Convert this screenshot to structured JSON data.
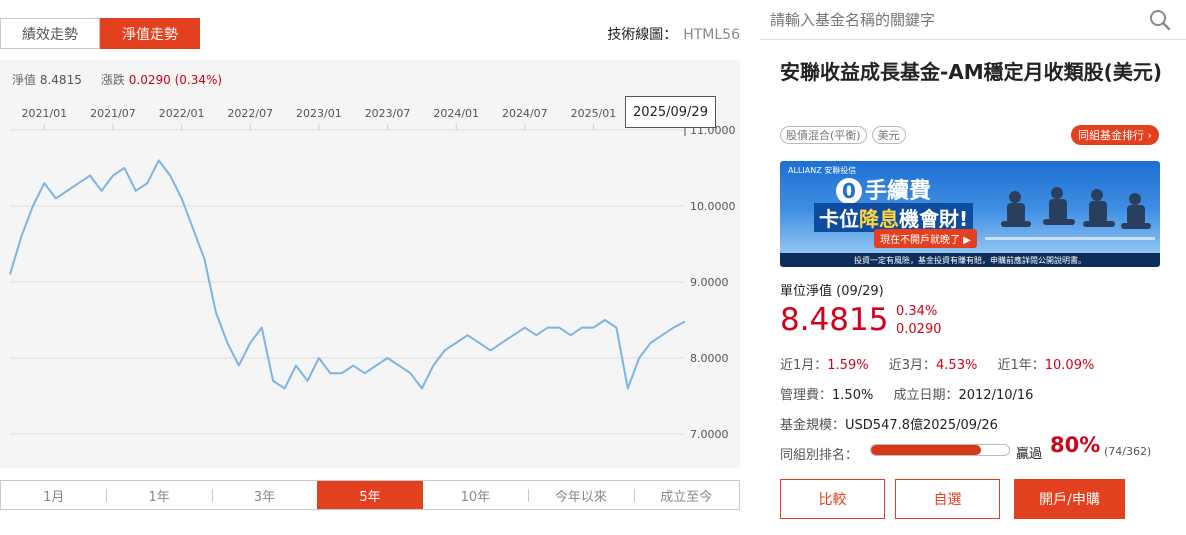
{
  "tabs": [
    {
      "label": "績效走勢",
      "active": false
    },
    {
      "label": "淨值走勢",
      "active": true
    }
  ],
  "tech": {
    "label": "技術線圖：",
    "value": "HTML56"
  },
  "nav_line": {
    "nav_label": "淨值",
    "nav_value": "8.4815",
    "change_label": "漲跌",
    "change_value": "0.0290 (0.34%)"
  },
  "tooltip_date": "2025/09/29",
  "ranges": [
    {
      "label": "1月",
      "active": false
    },
    {
      "label": "1年",
      "active": false
    },
    {
      "label": "3年",
      "active": false
    },
    {
      "label": "5年",
      "active": true
    },
    {
      "label": "10年",
      "active": false
    },
    {
      "label": "今年以來",
      "active": false
    },
    {
      "label": "成立至今",
      "active": false
    }
  ],
  "chart_data": {
    "type": "line",
    "title": "",
    "xlabel": "",
    "ylabel": "",
    "ylim": [
      7.0,
      11.0
    ],
    "y_ticks": [
      "11.0000",
      "10.0000",
      "9.0000",
      "8.0000",
      "7.0000"
    ],
    "x_ticks": [
      "2021/01",
      "2021/07",
      "2022/01",
      "2022/07",
      "2023/01",
      "2023/07",
      "2024/01",
      "2024/07",
      "2025/01"
    ],
    "grid": true,
    "line_color": "#7cb4e6",
    "series": [
      {
        "x": [
          "2020/10",
          "2020/11",
          "2020/12",
          "2021/01",
          "2021/02",
          "2021/03",
          "2021/04",
          "2021/05",
          "2021/06",
          "2021/07",
          "2021/08",
          "2021/09",
          "2021/10",
          "2021/11",
          "2021/12",
          "2022/01",
          "2022/02",
          "2022/03",
          "2022/04",
          "2022/05",
          "2022/06",
          "2022/07",
          "2022/08",
          "2022/09",
          "2022/10",
          "2022/11",
          "2022/12",
          "2023/01",
          "2023/02",
          "2023/03",
          "2023/04",
          "2023/05",
          "2023/06",
          "2023/07",
          "2023/08",
          "2023/09",
          "2023/10",
          "2023/11",
          "2023/12",
          "2024/01",
          "2024/02",
          "2024/03",
          "2024/04",
          "2024/05",
          "2024/06",
          "2024/07",
          "2024/08",
          "2024/09",
          "2024/10",
          "2024/11",
          "2024/12",
          "2025/01",
          "2025/02",
          "2025/03",
          "2025/04",
          "2025/05",
          "2025/06",
          "2025/07",
          "2025/08",
          "2025/09"
        ],
        "values": [
          9.1,
          9.6,
          10.0,
          10.3,
          10.1,
          10.2,
          10.3,
          10.4,
          10.2,
          10.4,
          10.5,
          10.2,
          10.3,
          10.6,
          10.4,
          10.1,
          9.7,
          9.3,
          8.6,
          8.2,
          7.9,
          8.2,
          8.4,
          7.7,
          7.6,
          7.9,
          7.7,
          8.0,
          7.8,
          7.8,
          7.9,
          7.8,
          7.9,
          8.0,
          7.9,
          7.8,
          7.6,
          7.9,
          8.1,
          8.2,
          8.3,
          8.2,
          8.1,
          8.2,
          8.3,
          8.4,
          8.3,
          8.4,
          8.4,
          8.3,
          8.4,
          8.4,
          8.5,
          8.4,
          7.6,
          8.0,
          8.2,
          8.3,
          8.4,
          8.48
        ]
      }
    ]
  },
  "search": {
    "placeholder": "請輸入基金名稱的關鍵字"
  },
  "fund": {
    "name": "安聯收益成長基金-AM穩定月收類股(美元)",
    "tags": [
      "股債混合(平衡)",
      "美元"
    ],
    "peer_rank_link": "同組基金排行 ›"
  },
  "banner": {
    "brand": "ALLIANZ 安聯投信",
    "line1_zero": "0",
    "line1": "手續費",
    "line2_a": "卡位",
    "line2_b": "降息",
    "line2_c": "機會財!",
    "line3": "現在不開戶就晚了 ▶",
    "footer": "投資一定有風險，基金投資有賺有賠，申購前應詳閱公開說明書。"
  },
  "unit_nav": {
    "label": "單位淨值 (09/29)",
    "value": "8.4815",
    "change_pct": "0.34%",
    "change_abs": "0.0290"
  },
  "returns": {
    "m1_label": "近1月：",
    "m1": "1.59%",
    "m3_label": "近3月：",
    "m3": "4.53%",
    "y1_label": "近1年：",
    "y1": "10.09%"
  },
  "info": {
    "fee_label": "管理費：",
    "fee": "1.50%",
    "date_label": "成立日期：",
    "date": "2012/10/16",
    "size_label": "基金規模：",
    "size": "USD547.8億2025/09/26"
  },
  "rank": {
    "label": "同組別排名：",
    "beat_label": "贏過",
    "percent": "80%",
    "fraction": 0.8,
    "count": "(74/362)"
  },
  "buttons": {
    "compare": "比較",
    "watch": "自選",
    "buy": "開戶/申購"
  }
}
